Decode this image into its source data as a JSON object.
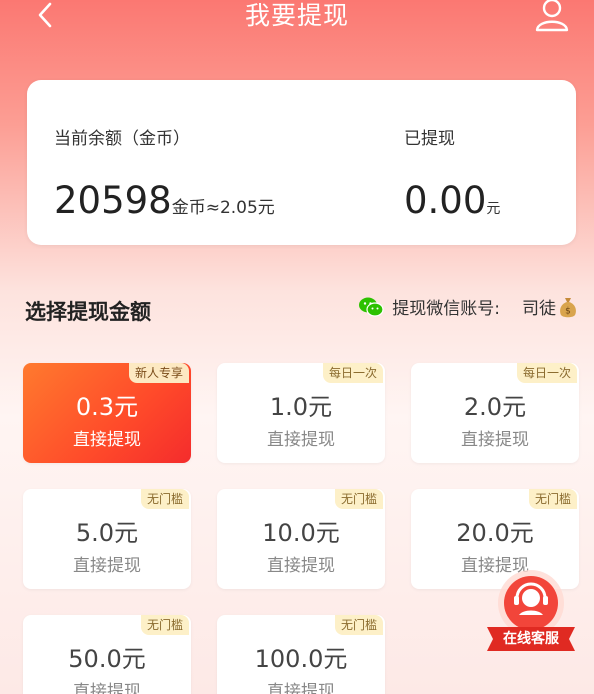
{
  "header": {
    "title": "我要提现"
  },
  "balance": {
    "label": "当前余额（金币）",
    "amount": "20598",
    "unit_text": "金币≈2.05元",
    "withdrawn_label": "已提现",
    "withdrawn_amount": "0.00",
    "withdrawn_unit": "元"
  },
  "section": {
    "title": "选择提现金额",
    "wechat_label": "提现微信账号:",
    "wechat_account": "司徒"
  },
  "amounts": [
    {
      "value": "0.3元",
      "sub": "直接提现",
      "badge": "新人专享",
      "selected": true
    },
    {
      "value": "1.0元",
      "sub": "直接提现",
      "badge": "每日一次",
      "selected": false
    },
    {
      "value": "2.0元",
      "sub": "直接提现",
      "badge": "每日一次",
      "selected": false
    },
    {
      "value": "5.0元",
      "sub": "直接提现",
      "badge": "无门槛",
      "selected": false
    },
    {
      "value": "10.0元",
      "sub": "直接提现",
      "badge": "无门槛",
      "selected": false
    },
    {
      "value": "20.0元",
      "sub": "直接提现",
      "badge": "无门槛",
      "selected": false
    },
    {
      "value": "50.0元",
      "sub": "直接提现",
      "badge": "无门槛",
      "selected": false
    },
    {
      "value": "100.0元",
      "sub": "直接提现",
      "badge": "无门槛",
      "selected": false
    }
  ],
  "service": {
    "label": "在线客服"
  },
  "colors": {
    "accent_red": "#f42c2c",
    "accent_orange": "#ff7a2e",
    "badge_bg": "#fdf0c8",
    "wechat_green": "#2dc100"
  },
  "icons": {
    "back": "back-arrow-icon",
    "user": "user-icon",
    "wechat": "wechat-icon",
    "money_bag": "money-bag-icon",
    "service": "headset-icon"
  }
}
